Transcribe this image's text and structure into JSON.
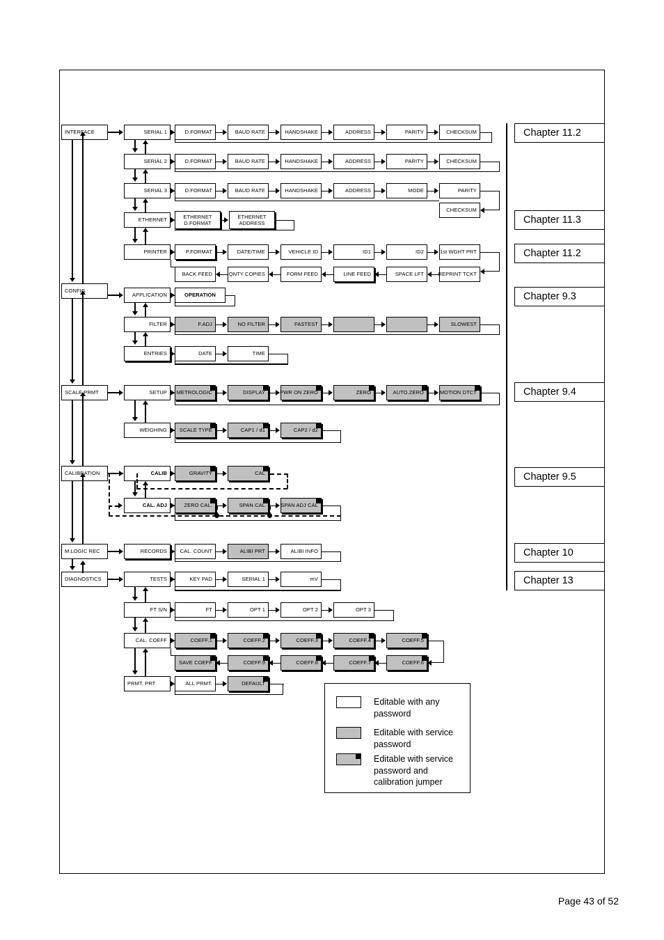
{
  "document": {
    "page_footer": "Page 43 of 52"
  },
  "legend": {
    "title": "",
    "items": [
      {
        "swatch": "white",
        "text": "Editable with any password"
      },
      {
        "swatch": "gray",
        "text": "Editable with service password"
      },
      {
        "swatch": "gray-jumper",
        "text": "Editable with service password and calibration jumper"
      }
    ]
  },
  "chapters": [
    {
      "label": "Chapter 11.2"
    },
    {
      "label": "Chapter 11.3"
    },
    {
      "label": "Chapter 11.2"
    },
    {
      "label": "Chapter 9.3"
    },
    {
      "label": "Chapter 9.4"
    },
    {
      "label": "Chapter 9.5"
    },
    {
      "label": "Chapter 10"
    },
    {
      "label": "Chapter 13"
    }
  ],
  "menu": {
    "roots": [
      {
        "label": "INTERFACE"
      },
      {
        "label": "CONFIG"
      },
      {
        "label": "SCALE PRMT"
      },
      {
        "label": "CALIBRATION"
      },
      {
        "label": "M.LOGIC REC"
      },
      {
        "label": "DIAGNOSTICS"
      }
    ],
    "groups": [
      {
        "label": "SERIAL 1"
      },
      {
        "label": "SERIAL 2"
      },
      {
        "label": "SERIAL 3"
      },
      {
        "label": "ETHERNET"
      },
      {
        "label": "PRINTER"
      },
      {
        "label": "APPLICATION"
      },
      {
        "label": "FILTER"
      },
      {
        "label": "ENTRIES"
      },
      {
        "label": "SETUP"
      },
      {
        "label": "WEIGHING"
      },
      {
        "label": "CALIB"
      },
      {
        "label": "CAL. ADJ"
      },
      {
        "label": "RECORDS"
      },
      {
        "label": "TESTS"
      },
      {
        "label": "FT S/N"
      },
      {
        "label": "CAL. COEFF"
      },
      {
        "label": "PRMT. PRT"
      }
    ],
    "rows": {
      "serial1": [
        "D.FORMAT",
        "BAUD RATE",
        "HANDSHAKE",
        "ADDRESS",
        "PARITY",
        "CHECKSUM"
      ],
      "serial2": [
        "D.FORMAT",
        "BAUD RATE",
        "HANDSHAKE",
        "ADDRESS",
        "PARITY",
        "CHECKSUM"
      ],
      "serial3": [
        "D.FORMAT",
        "BAUD RATE",
        "HANDSHAKE",
        "ADDRESS",
        "MODE",
        "PARITY"
      ],
      "serial3_wrap": [
        "CHECKSUM"
      ],
      "ethernet": [
        "ETHERNET D.FORMAT",
        "ETHERNET ADDRESS"
      ],
      "ethernet_l1": [
        "ETHERNET",
        "ETHERNET"
      ],
      "ethernet_l2": [
        "D.FORMAT",
        "ADDRESS"
      ],
      "printer_top": [
        "P.FORMAT",
        "DATE/TIME",
        "VEHICLE ID",
        "ID1",
        "ID2",
        "1st WGHT PRT"
      ],
      "printer_bot": [
        "BACK FEED",
        "QNTY COPIES",
        "FORM FEED",
        "LINE FEED",
        "SPACE LFT",
        "REPRINT TCKT"
      ],
      "application": [
        "OPERATION"
      ],
      "filter": [
        "F.ADJ",
        "NO FILTER",
        "FASTEST",
        "",
        "",
        "SLOWEST"
      ],
      "entries": [
        "DATE",
        "TIME"
      ],
      "setup": [
        "METROLOGIC",
        "DISPLAY",
        "PWR ON ZERO",
        "ZERO",
        "AUTO.ZERO",
        "MOTION DTCT"
      ],
      "weighing": [
        "SCALE TYPE",
        "CAP1 / d1",
        "CAP2 / d2"
      ],
      "calib": [
        "GRAVITY",
        "CAL"
      ],
      "cal_adj": [
        "ZERO CAL.",
        "SPAN CAL",
        "SPAN ADJ CAL"
      ],
      "records": [
        "CAL. COUNT",
        "ALIBI PRT",
        "ALIBI INFO"
      ],
      "tests": [
        "KEY PAD",
        "SERIAL 1",
        "mV"
      ],
      "ft_sn": [
        "FT",
        "OPT 1",
        "OPT 2",
        "OPT 3"
      ],
      "coeff_top": [
        "COEFF.1",
        "COEFF.2",
        "COEFF.3",
        "COEFF.4",
        "COEFF.5"
      ],
      "coeff_bot": [
        "SAVE COEFF",
        "COEFF.9",
        "COEFF.8",
        "COEFF.7",
        "COEFF.6"
      ],
      "prmt_prt": [
        "ALL PRMT.",
        "DEFAULT"
      ]
    }
  },
  "colors": {
    "service_fill": "#c0c0c0",
    "any_fill": "#ffffff",
    "line": "#000000"
  }
}
